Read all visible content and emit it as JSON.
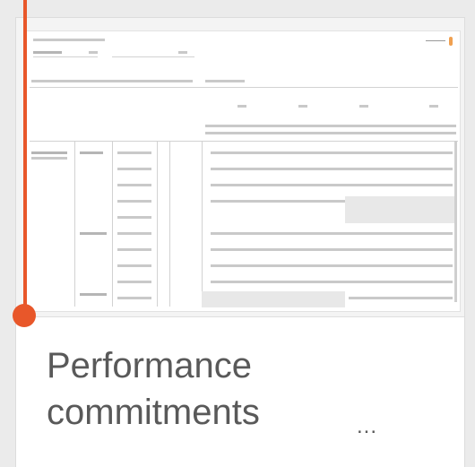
{
  "card": {
    "title": "Performance commitments",
    "more_label": "...",
    "accent_color": "#e8572a"
  }
}
